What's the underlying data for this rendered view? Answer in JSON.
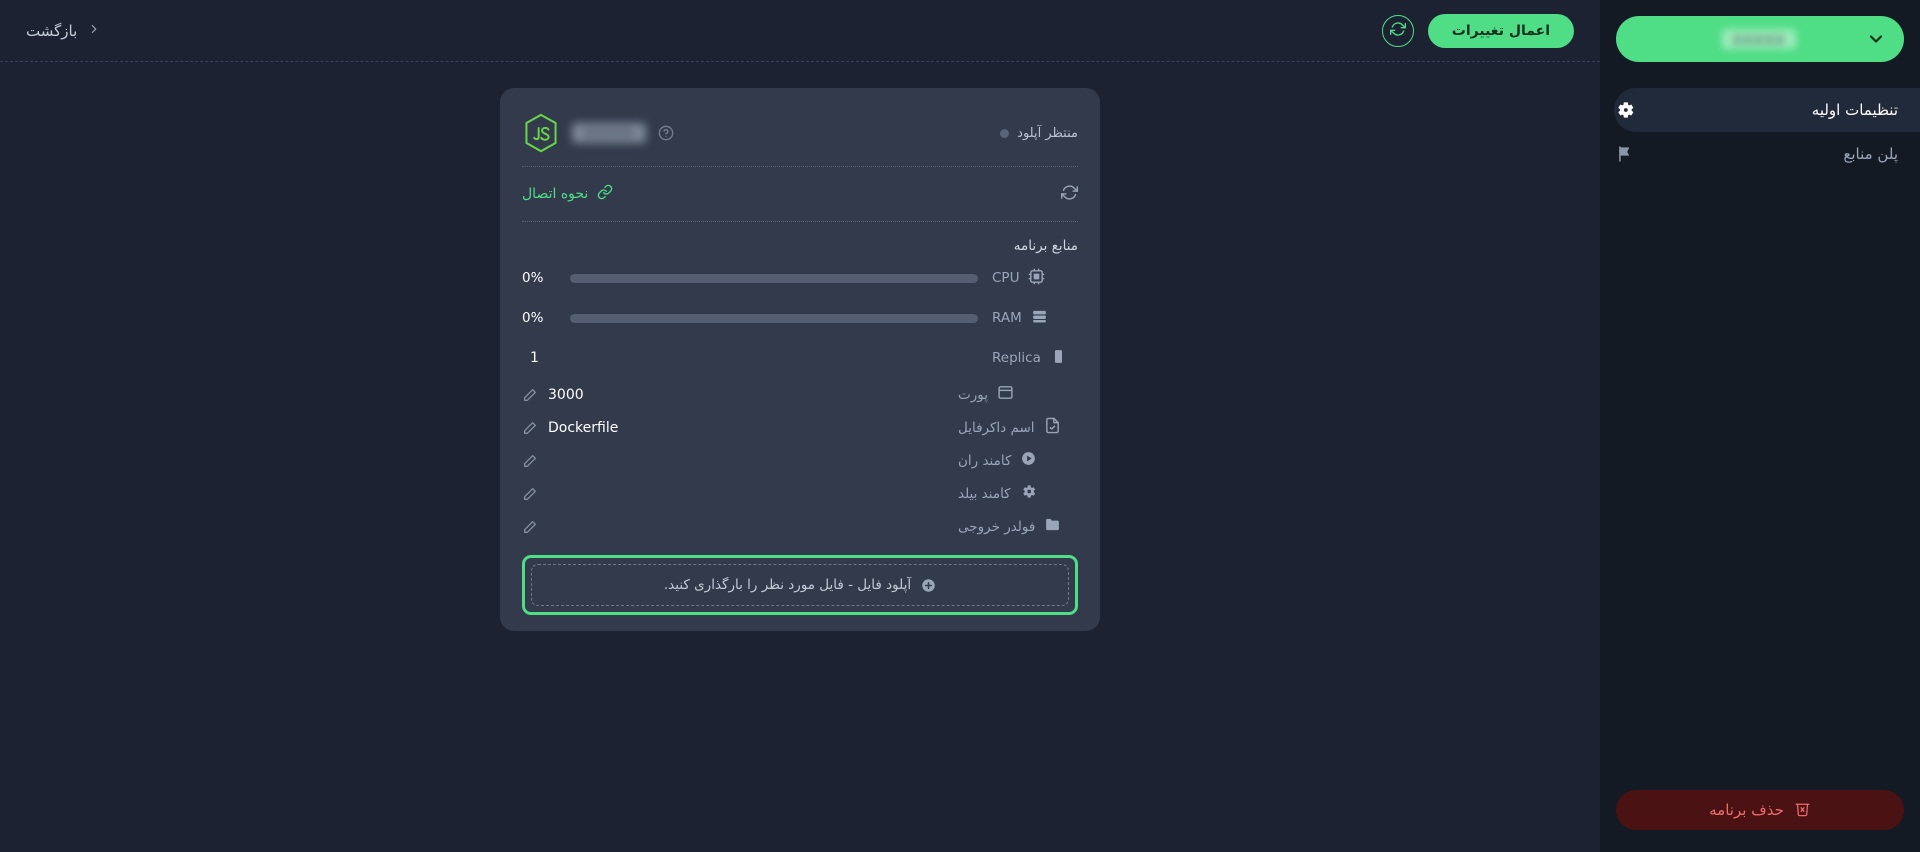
{
  "topbar": {
    "apply_label": "اعمال تغییرات",
    "refresh_icon": "refresh-icon",
    "back_label": "بازگشت",
    "back_chevron_icon": "chevron-left-icon"
  },
  "sidebar": {
    "project_selector": {
      "name_redacted": "xxxxx",
      "chevron_icon": "chevron-down-icon"
    },
    "items": [
      {
        "label": "تنظیمات اولیه",
        "icon": "gear-icon",
        "active": true
      },
      {
        "label": "پلن منابع",
        "icon": "flag-icon",
        "active": false
      }
    ],
    "delete_button": {
      "label": "حذف برنامه",
      "icon": "trash-x-icon"
    }
  },
  "card": {
    "runtime_logo": "nodejs-js-icon",
    "app_name_redacted": "xxxxx",
    "help_icon": "question-circle-icon",
    "status_text": "منتظر آپلود",
    "status_dot": "status-dot-idle",
    "connection": {
      "label": "نحوه اتصال",
      "link_icon": "link-icon",
      "refresh_icon": "refresh-icon"
    },
    "resources_title": "منابع برنامه",
    "meters": [
      {
        "label": "CPU",
        "icon": "cpu-icon",
        "value": "0%",
        "percent": 0
      },
      {
        "label": "RAM",
        "icon": "ram-icon",
        "value": "0%",
        "percent": 0
      }
    ],
    "replica": {
      "label": "Replica",
      "icon": "replica-icon",
      "value": "1"
    },
    "fields": [
      {
        "label": "پورت",
        "icon": "window-icon",
        "value": "3000",
        "edit_icon": "edit-pencil-icon"
      },
      {
        "label": "اسم داکرفایل",
        "icon": "file-check-icon",
        "value": "Dockerfile",
        "edit_icon": "edit-pencil-icon"
      },
      {
        "label": "کامند ران",
        "icon": "play-circle-icon",
        "value": "",
        "edit_icon": "edit-pencil-icon"
      },
      {
        "label": "کامند بیلد",
        "icon": "gear-icon",
        "value": "",
        "edit_icon": "edit-pencil-icon"
      },
      {
        "label": "فولدر خروجی",
        "icon": "folder-icon",
        "value": "",
        "edit_icon": "edit-pencil-icon"
      }
    ],
    "upload": {
      "text": "آپلود فایل - فایل مورد نظر را بارگذاری کنید.",
      "plus_icon": "plus-circle-icon"
    }
  },
  "colors": {
    "accent_green": "#4fdd86",
    "page_bg": "#1c2231",
    "sidebar_bg": "#141a24",
    "card_bg": "#323a4b",
    "danger_bg": "#4a1212",
    "danger_fg": "#ef6b6b"
  }
}
